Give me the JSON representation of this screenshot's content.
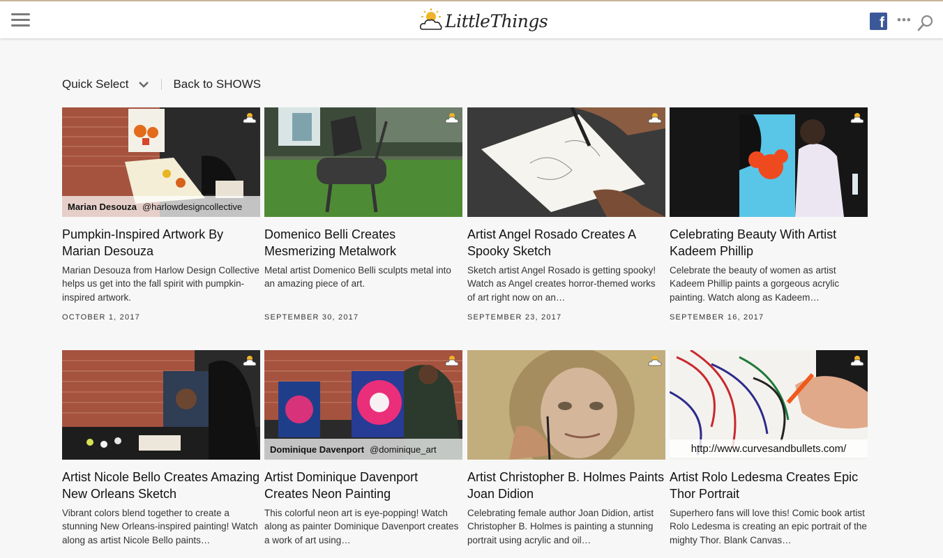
{
  "header": {
    "logo_text": "LittleThings",
    "brand_colors": {
      "facebook": "#3b5998",
      "logo_sun": "#f0b429"
    }
  },
  "subnav": {
    "quick_select_label": "Quick Select",
    "back_label": "Back to SHOWS"
  },
  "cards": [
    {
      "title": "Pumpkin-Inspired Artwork By Marian Desouza",
      "description": "Marian Desouza from Harlow Design Collective helps us get into the fall spirit with pumpkin-inspired artwork.",
      "date": "OCTOBER 1, 2017",
      "caption_name": "Marian Desouza",
      "caption_handle": "@harlowdesigncollective"
    },
    {
      "title": "Domenico Belli Creates Mesmerizing Metalwork",
      "description": "Metal artist Domenico Belli sculpts metal into an amazing piece of art.",
      "date": "SEPTEMBER 30, 2017"
    },
    {
      "title": "Artist Angel Rosado Creates A Spooky Sketch",
      "description": "Sketch artist Angel Rosado is getting spooky! Watch as Angel creates horror-themed works of art right now on an…",
      "date": "SEPTEMBER 23, 2017"
    },
    {
      "title": "Celebrating Beauty With Artist Kadeem Phillip",
      "description": "Celebrate the beauty of women as artist Kadeem Phillip paints a gorgeous acrylic painting. Watch along as Kadeem…",
      "date": "SEPTEMBER 16, 2017"
    },
    {
      "title": "Artist Nicole Bello Creates Amazing New Orleans Sketch",
      "description": "Vibrant colors blend together to create a stunning New Orleans-inspired painting! Watch along as artist Nicole Bello paints…"
    },
    {
      "title": "Artist Dominique Davenport Creates Neon Painting",
      "description": "This colorful neon art is eye-popping! Watch along as painter Dominique Davenport creates a work of art using…",
      "caption_name": "Dominique Davenport",
      "caption_handle": "@dominique_art"
    },
    {
      "title": "Artist Christopher B. Holmes Paints Joan Didion",
      "description": "Celebrating female author Joan Didion, artist Christopher B. Holmes is painting a stunning portrait using acrylic and oil…"
    },
    {
      "title": "Artist Rolo Ledesma Creates Epic Thor Portrait",
      "description": "Superhero fans will love this! Comic book artist Rolo Ledesma is creating an epic portrait of the mighty Thor. Blank Canvas…",
      "caption_url": "http://www.curvesandbullets.com/"
    }
  ]
}
